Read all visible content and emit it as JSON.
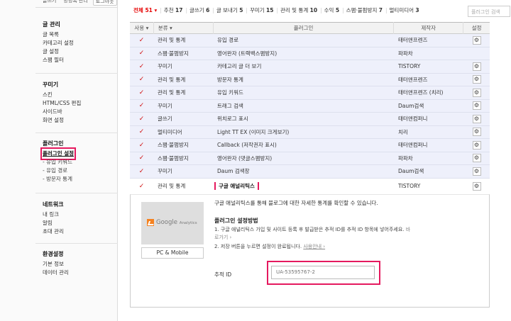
{
  "sidebar": {
    "top_links": [
      "글쓰기",
      "방명록 관리",
      "로그아웃"
    ],
    "groups": [
      {
        "title": "글 관리",
        "items": [
          "글 목록",
          "카테고리 설정",
          "글 설정",
          "스팸 필터"
        ]
      },
      {
        "title": "꾸미기",
        "items": [
          "스킨",
          "HTML/CSS 편집",
          "사이드바",
          "화면 설정"
        ]
      },
      {
        "title": "플러그인",
        "items": [
          "플러그인 설정",
          "- 유입 키워드",
          "- 유입 경로",
          "- 방문자 통계"
        ]
      },
      {
        "title": "네트워크",
        "items": [
          "내 링크",
          "알림",
          "초대 관리"
        ]
      },
      {
        "title": "환경설정",
        "items": [
          "기본 정보",
          "데이터 관리"
        ]
      }
    ]
  },
  "filters": [
    {
      "label": "전체",
      "count": "51"
    },
    {
      "label": "추천",
      "count": "17"
    },
    {
      "label": "글쓰기",
      "count": "6"
    },
    {
      "label": "글 보내기",
      "count": "5"
    },
    {
      "label": "꾸미기",
      "count": "15"
    },
    {
      "label": "관리 및 통계",
      "count": "10"
    },
    {
      "label": "수익",
      "count": "5"
    },
    {
      "label": "스팸·불펌방지",
      "count": "7"
    },
    {
      "label": "멀티미디어",
      "count": "3"
    }
  ],
  "filter_arrow": "▾",
  "search": {
    "placeholder": "플러그인 검색"
  },
  "table": {
    "headers": {
      "use": "사용",
      "category": "분류",
      "plugin": "플러그인",
      "maker": "제작자",
      "settings": "설정"
    },
    "header_arrow": "▾",
    "check": "✓",
    "gear": "⚙",
    "rows": [
      {
        "category": "관리 및 통계",
        "name": "유입 경로",
        "maker": "태터앤프렌즈",
        "settings": true
      },
      {
        "category": "스팸·불펌방지",
        "name": "영어완자 (트랙백스팸방지)",
        "maker": "파파차",
        "settings": false
      },
      {
        "category": "꾸미기",
        "name": "카테고리 글 더 보기",
        "maker": "TISTORY",
        "settings": true
      },
      {
        "category": "관리 및 통계",
        "name": "방문자 통계",
        "maker": "태터앤프렌즈",
        "settings": true
      },
      {
        "category": "관리 및 통계",
        "name": "유입 키워드",
        "maker": "태터앤프렌즈 (치리)",
        "settings": true
      },
      {
        "category": "꾸미기",
        "name": "트래그 검색",
        "maker": "Daum검색",
        "settings": true
      },
      {
        "category": "글쓰기",
        "name": "위치로그 표시",
        "maker": "태터앤컴퍼니",
        "settings": true
      },
      {
        "category": "멀티미디어",
        "name": "Light TT EX (이미지 크게보기)",
        "maker": "치리",
        "settings": true
      },
      {
        "category": "스팸·불펌방지",
        "name": "Callback (저작권자 표시)",
        "maker": "태터앤컴퍼니",
        "settings": true
      },
      {
        "category": "스팸·불펌방지",
        "name": "영어완자 (댓글스팸방지)",
        "maker": "파파차",
        "settings": true
      },
      {
        "category": "꾸미기",
        "name": "Daum 검색창",
        "maker": "Daum검색",
        "settings": true
      }
    ],
    "selected": {
      "category": "관리 및 통계",
      "name": "구글 애널리틱스",
      "maker": "TISTORY"
    }
  },
  "detail": {
    "logo_text": "Google",
    "logo_small": "Analytics",
    "pc_mobile": "PC & Mobile",
    "description": "구글 애널리틱스를 통해 블로그에 대한 자세한 통계를 확인할 수 있습니다.",
    "how_title": "플러그인 설정방법",
    "how_step1": "1. 구글 애널리틱스 가입 및 사이트 등록 후 발급받은 추적 ID를 추적 ID 항목에 넣어주세요.",
    "how_step1_link_a": "바",
    "how_step1_link_b": "로가기 ›",
    "how_step2": "2. 저장 버튼을 누르면 설정이 완료됩니다.",
    "how_step2_link": "사용안내 ›",
    "track_label": "추적 ID",
    "track_placeholder": "UA-53595767-2"
  }
}
